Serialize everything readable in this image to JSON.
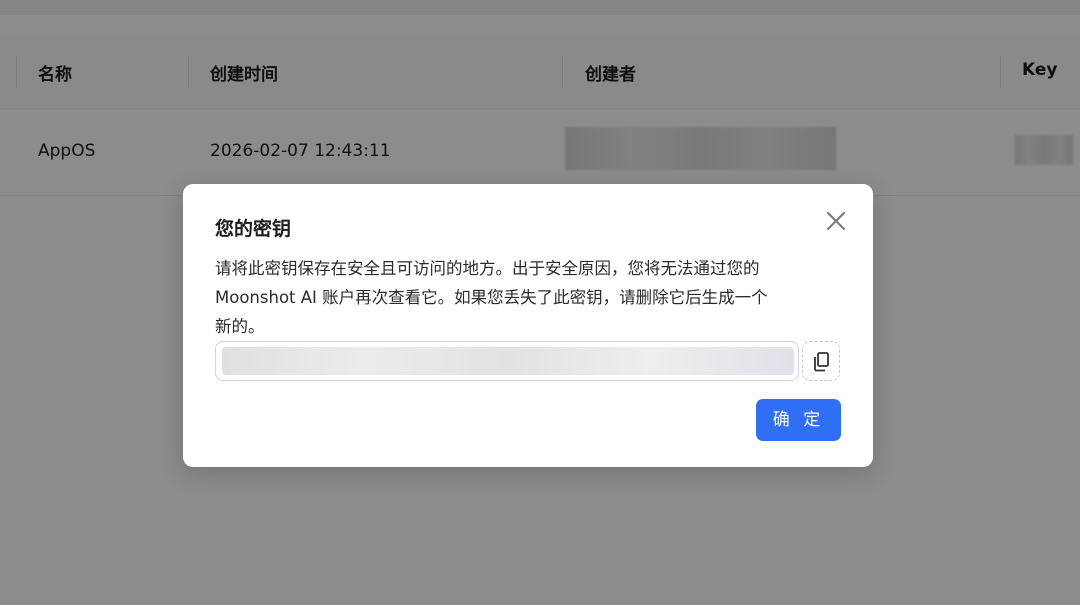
{
  "table": {
    "headers": [
      "名称",
      "创建时间",
      "创建者",
      "Key"
    ],
    "rows": [
      {
        "name": "AppOS",
        "created_at": "2026-02-07 12:43:11"
      }
    ]
  },
  "modal": {
    "title": "您的密钥",
    "description_line1": "请将此密钥保存在安全且可访问的地方。出于安全原因，您将无法通过您的",
    "description_line2": "Moonshot AI 账户再次查看它。如果您丢失了此密钥，请删除它后生成一个",
    "description_line3": "新的。",
    "confirm_label": "确 定",
    "close_icon": "close-icon",
    "copy_icon": "copy-icon"
  },
  "colors": {
    "primary": "#2f6ff4",
    "overlay": "rgba(0,0,0,0.45)"
  }
}
